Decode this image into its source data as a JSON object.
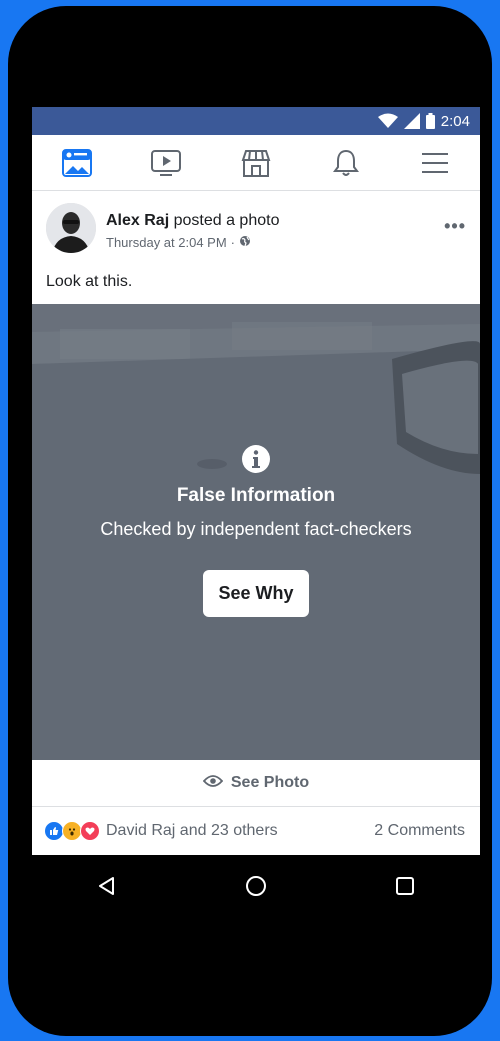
{
  "status_bar": {
    "time": "2:04"
  },
  "navbar": {
    "items": [
      "news-feed-icon",
      "watch-icon",
      "marketplace-icon",
      "notifications-icon",
      "menu-icon"
    ]
  },
  "post": {
    "author": "Alex Raj",
    "action": "posted a photo",
    "timestamp": "Thursday at 2:04 PM",
    "separator": "·",
    "privacy_icon": "globe-icon",
    "more_label": "•••",
    "text": "Look at this."
  },
  "fact_check": {
    "icon": "info-icon",
    "title": "False Information",
    "subtitle": "Checked by independent fact-checkers",
    "button_label": "See Why"
  },
  "see_photo": {
    "icon": "eye-icon",
    "label": "See Photo"
  },
  "reactions": {
    "icons": [
      "like-icon",
      "wow-icon",
      "love-icon"
    ],
    "text": "David Raj and 23 others",
    "comments": "2 Comments"
  },
  "colors": {
    "brand": "#3b5998",
    "accent": "#1877f2",
    "reaction_like": "#1877f2",
    "reaction_love": "#f33e58",
    "reaction_wow": "#f7b125"
  }
}
